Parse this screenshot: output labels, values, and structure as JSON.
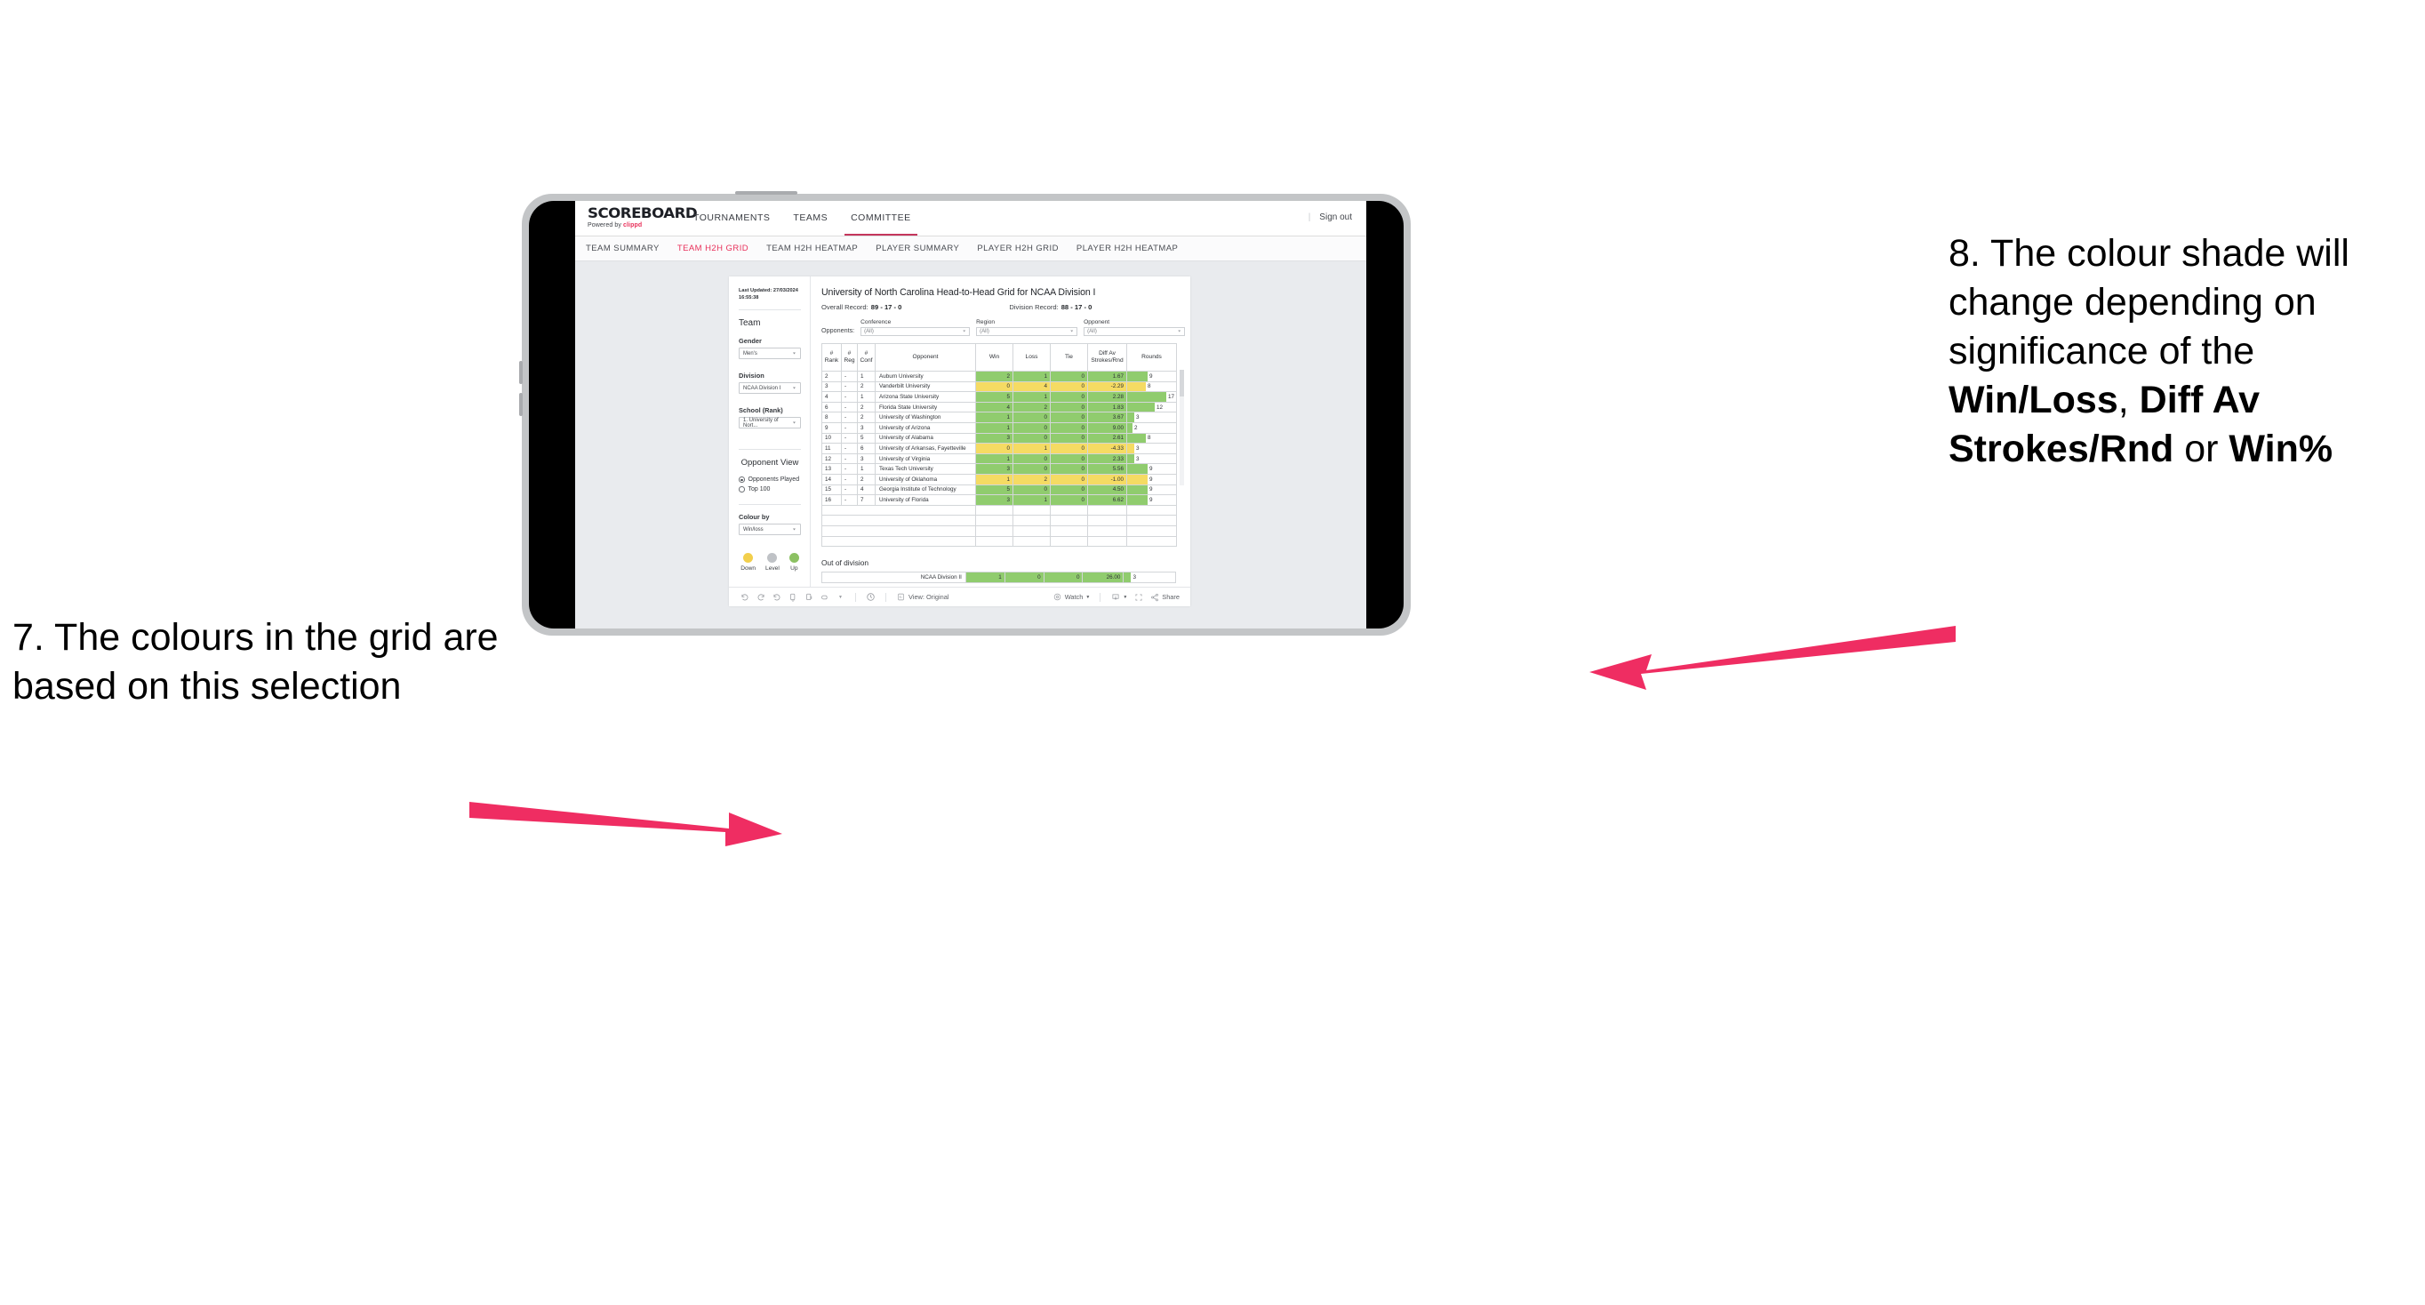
{
  "annotations": {
    "left": {
      "number": "7.",
      "text": "The colours in the grid are based on this selection"
    },
    "right": {
      "number": "8.",
      "text_before": "The colour shade will change depending on significance of the ",
      "bold1": "Win/Loss",
      "mid1": ", ",
      "bold2": "Diff Av Strokes/Rnd",
      "mid2": " or ",
      "bold3": "Win%"
    }
  },
  "header": {
    "logo_main": "SCOREBOARD",
    "logo_sub_prefix": "Powered by ",
    "logo_brand": "clippd",
    "nav": [
      {
        "label": "TOURNAMENTS",
        "active": false
      },
      {
        "label": "TEAMS",
        "active": false
      },
      {
        "label": "COMMITTEE",
        "active": true
      }
    ],
    "divider": "|",
    "signout": "Sign out"
  },
  "subtabs": [
    {
      "label": "TEAM SUMMARY",
      "active": false
    },
    {
      "label": "TEAM H2H GRID",
      "active": true
    },
    {
      "label": "TEAM H2H HEATMAP",
      "active": false
    },
    {
      "label": "PLAYER SUMMARY",
      "active": false
    },
    {
      "label": "PLAYER H2H GRID",
      "active": false
    },
    {
      "label": "PLAYER H2H HEATMAP",
      "active": false
    }
  ],
  "sidebar": {
    "last_updated": "Last Updated: 27/03/2024 16:55:38",
    "team_heading": "Team",
    "gender_label": "Gender",
    "gender_value": "Men's",
    "division_label": "Division",
    "division_value": "NCAA Division I",
    "school_label": "School (Rank)",
    "school_value": "1. University of Nort...",
    "opponent_view_heading": "Opponent View",
    "opponent_view_options": [
      {
        "label": "Opponents Played",
        "selected": true
      },
      {
        "label": "Top 100",
        "selected": false
      }
    ],
    "colour_by_label": "Colour by",
    "colour_by_value": "Win/loss",
    "legend": [
      {
        "label": "Down",
        "color": "#f2cf4c"
      },
      {
        "label": "Level",
        "color": "#bfc2c6"
      },
      {
        "label": "Up",
        "color": "#8cc163"
      }
    ]
  },
  "viz": {
    "title": "University of North Carolina Head-to-Head Grid for NCAA Division I",
    "overall_record_label": "Overall Record:",
    "overall_record_value": "89 - 17 - 0",
    "division_record_label": "Division Record:",
    "division_record_value": "88 - 17 - 0",
    "opponents_label": "Opponents:",
    "filters": [
      {
        "label": "Conference",
        "value": "(All)"
      },
      {
        "label": "Region",
        "value": "(All)"
      },
      {
        "label": "Opponent",
        "value": "(All)"
      }
    ],
    "out_of_division_title": "Out of division"
  },
  "chart_data": {
    "type": "table",
    "title": "University of North Carolina Head-to-Head Grid for NCAA Division I",
    "columns": [
      "# Rank",
      "# Reg",
      "# Conf",
      "Opponent",
      "Win",
      "Loss",
      "Tie",
      "Diff Av Strokes/Rnd",
      "Rounds"
    ],
    "colour_by": "Win/loss",
    "colours": {
      "up": "#90cc6e",
      "down": "#f5db63",
      "level": "#bfc2c6"
    },
    "rounds_max": 17,
    "rows": [
      {
        "rank": "2",
        "reg": "-",
        "conf": "1",
        "opponent": "Auburn University",
        "win": "2",
        "loss": "1",
        "tie": "0",
        "diff": "1.67",
        "rounds": "9",
        "state": "up"
      },
      {
        "rank": "3",
        "reg": "-",
        "conf": "2",
        "opponent": "Vanderbilt University",
        "win": "0",
        "loss": "4",
        "tie": "0",
        "diff": "-2.29",
        "rounds": "8",
        "state": "down"
      },
      {
        "rank": "4",
        "reg": "-",
        "conf": "1",
        "opponent": "Arizona State University",
        "win": "5",
        "loss": "1",
        "tie": "0",
        "diff": "2.28",
        "rounds": "17",
        "state": "up"
      },
      {
        "rank": "6",
        "reg": "-",
        "conf": "2",
        "opponent": "Florida State University",
        "win": "4",
        "loss": "2",
        "tie": "0",
        "diff": "1.83",
        "rounds": "12",
        "state": "up"
      },
      {
        "rank": "8",
        "reg": "-",
        "conf": "2",
        "opponent": "University of Washington",
        "win": "1",
        "loss": "0",
        "tie": "0",
        "diff": "3.67",
        "rounds": "3",
        "state": "up"
      },
      {
        "rank": "9",
        "reg": "-",
        "conf": "3",
        "opponent": "University of Arizona",
        "win": "1",
        "loss": "0",
        "tie": "0",
        "diff": "9.00",
        "rounds": "2",
        "state": "up"
      },
      {
        "rank": "10",
        "reg": "-",
        "conf": "5",
        "opponent": "University of Alabama",
        "win": "3",
        "loss": "0",
        "tie": "0",
        "diff": "2.61",
        "rounds": "8",
        "state": "up"
      },
      {
        "rank": "11",
        "reg": "-",
        "conf": "6",
        "opponent": "University of Arkansas, Fayetteville",
        "win": "0",
        "loss": "1",
        "tie": "0",
        "diff": "-4.33",
        "rounds": "3",
        "state": "down"
      },
      {
        "rank": "12",
        "reg": "-",
        "conf": "3",
        "opponent": "University of Virginia",
        "win": "1",
        "loss": "0",
        "tie": "0",
        "diff": "2.33",
        "rounds": "3",
        "state": "up"
      },
      {
        "rank": "13",
        "reg": "-",
        "conf": "1",
        "opponent": "Texas Tech University",
        "win": "3",
        "loss": "0",
        "tie": "0",
        "diff": "5.56",
        "rounds": "9",
        "state": "up"
      },
      {
        "rank": "14",
        "reg": "-",
        "conf": "2",
        "opponent": "University of Oklahoma",
        "win": "1",
        "loss": "2",
        "tie": "0",
        "diff": "-1.00",
        "rounds": "9",
        "state": "down"
      },
      {
        "rank": "15",
        "reg": "-",
        "conf": "4",
        "opponent": "Georgia Institute of Technology",
        "win": "5",
        "loss": "0",
        "tie": "0",
        "diff": "4.50",
        "rounds": "9",
        "state": "up"
      },
      {
        "rank": "16",
        "reg": "-",
        "conf": "7",
        "opponent": "University of Florida",
        "win": "3",
        "loss": "1",
        "tie": "0",
        "diff": "6.62",
        "rounds": "9",
        "state": "up"
      }
    ],
    "out_of_division": [
      {
        "opponent": "NCAA Division II",
        "win": "1",
        "loss": "0",
        "tie": "0",
        "diff": "26.00",
        "rounds": "3",
        "state": "up"
      }
    ]
  },
  "toolbar": {
    "view_label": "View: Original",
    "watch_label": "Watch",
    "share_label": "Share"
  }
}
